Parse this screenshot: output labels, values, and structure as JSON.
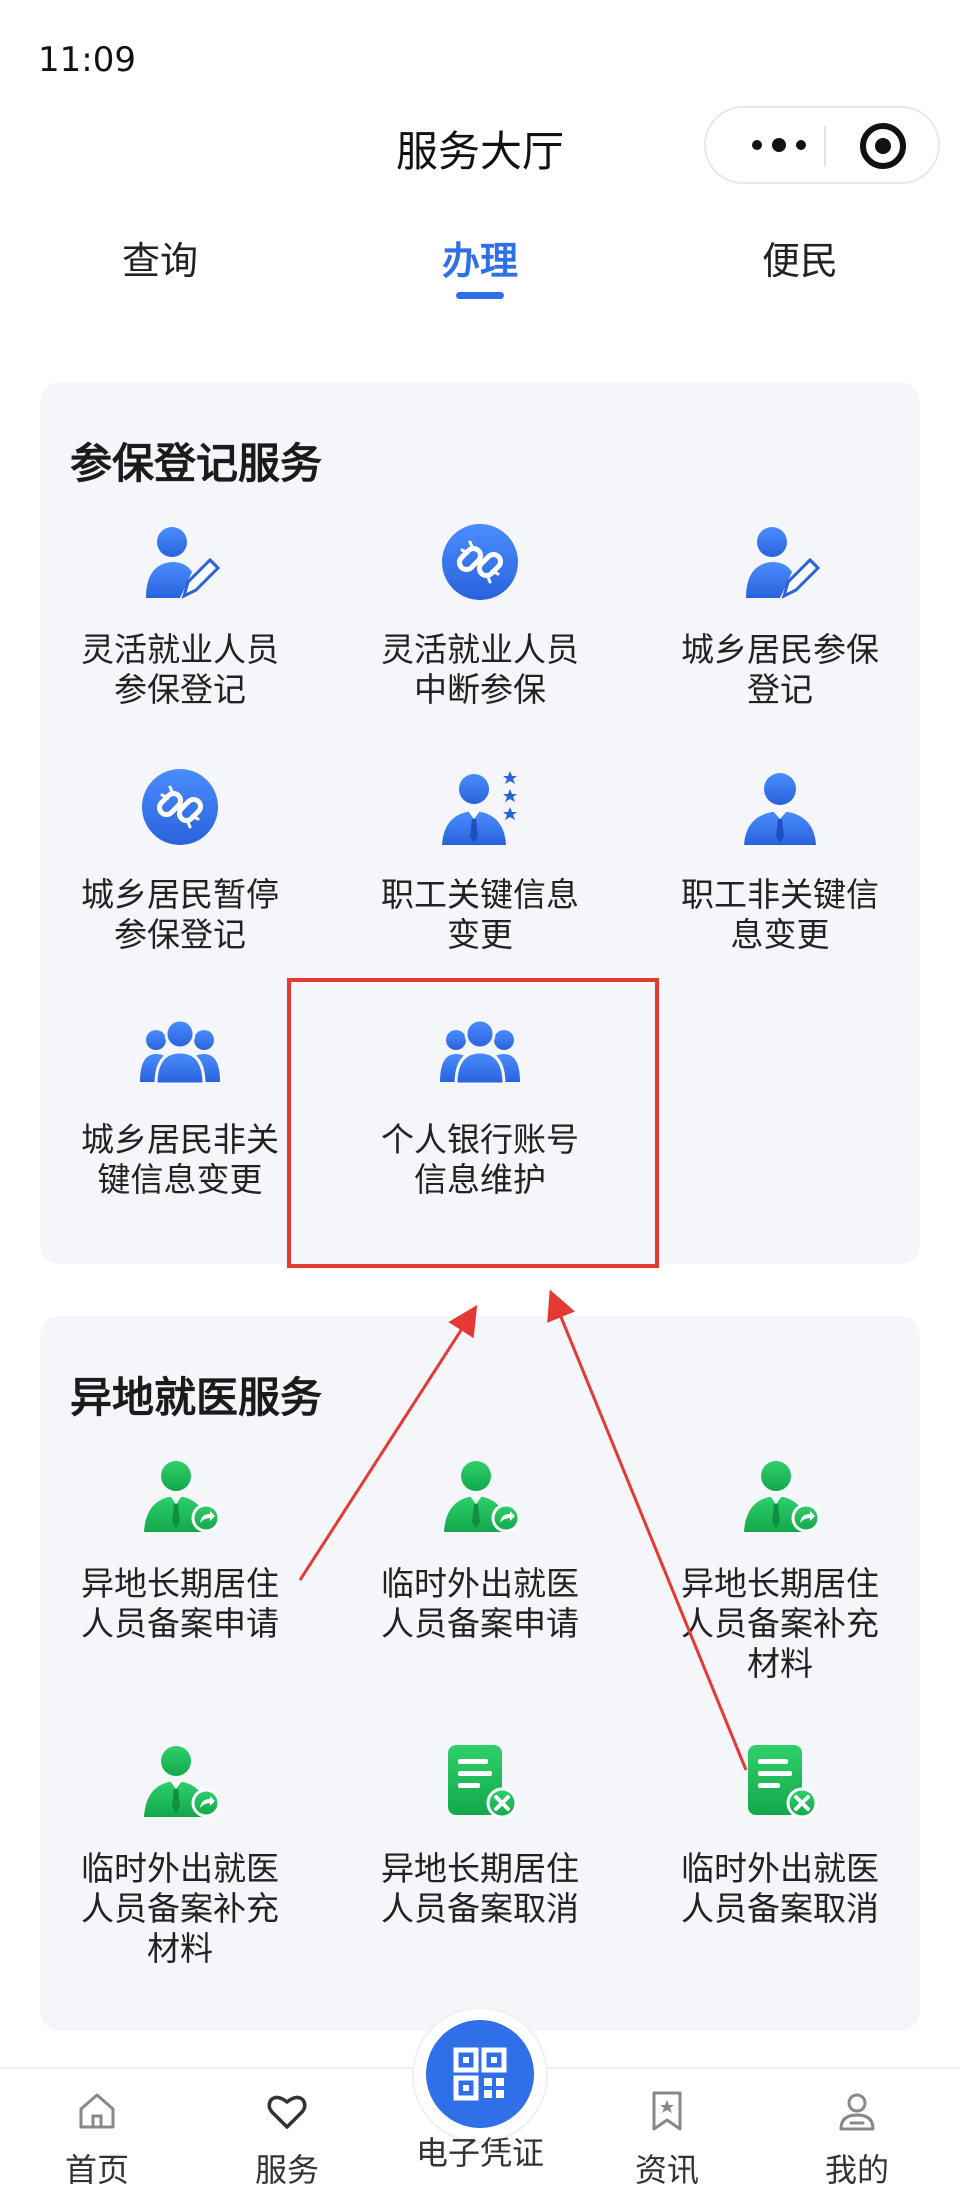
{
  "status": {
    "time": "11:09"
  },
  "nav": {
    "title": "服务大厅"
  },
  "tabs": [
    {
      "label": "查询"
    },
    {
      "label": "办理"
    },
    {
      "label": "便民"
    }
  ],
  "colors": {
    "accent": "#2f6fe8",
    "green": "#18b957",
    "highlight": "#e53935"
  },
  "section1": {
    "title": "参保登记服务",
    "items": [
      {
        "line1": "灵活就业人员",
        "line2": "参保登记",
        "icon": "person-edit-icon"
      },
      {
        "line1": "灵活就业人员",
        "line2": "中断参保",
        "icon": "broken-link-icon"
      },
      {
        "line1": "城乡居民参保",
        "line2": "登记",
        "icon": "person-edit-icon"
      },
      {
        "line1": "城乡居民暂停",
        "line2": "参保登记",
        "icon": "broken-link-icon"
      },
      {
        "line1": "职工关键信息",
        "line2": "变更",
        "icon": "person-stars-icon"
      },
      {
        "line1": "职工非关键信",
        "line2": "息变更",
        "icon": "person-tie-icon"
      },
      {
        "line1": "城乡居民非关",
        "line2": "键信息变更",
        "icon": "group-icon"
      },
      {
        "line1": "个人银行账号",
        "line2": "信息维护",
        "icon": "group-icon"
      }
    ]
  },
  "section2": {
    "title": "异地就医服务",
    "items": [
      {
        "line1": "异地长期居住",
        "line2": "人员备案申请",
        "line3": "",
        "icon": "person-share-icon"
      },
      {
        "line1": "临时外出就医",
        "line2": "人员备案申请",
        "line3": "",
        "icon": "person-share-icon"
      },
      {
        "line1": "异地长期居住",
        "line2": "人员备案补充",
        "line3": "材料",
        "icon": "person-share-icon"
      },
      {
        "line1": "临时外出就医",
        "line2": "人员备案补充",
        "line3": "材料",
        "icon": "person-share-icon"
      },
      {
        "line1": "异地长期居住",
        "line2": "人员备案取消",
        "line3": "",
        "icon": "document-cancel-icon"
      },
      {
        "line1": "临时外出就医",
        "line2": "人员备案取消",
        "line3": "",
        "icon": "document-cancel-icon"
      }
    ]
  },
  "tabbar": [
    {
      "label": "首页",
      "icon": "home-icon"
    },
    {
      "label": "服务",
      "icon": "heart-icon"
    },
    {
      "label": "电子凭证",
      "icon": "qr-code-icon"
    },
    {
      "label": "资讯",
      "icon": "bookmark-star-icon"
    },
    {
      "label": "我的",
      "icon": "user-icon"
    }
  ]
}
